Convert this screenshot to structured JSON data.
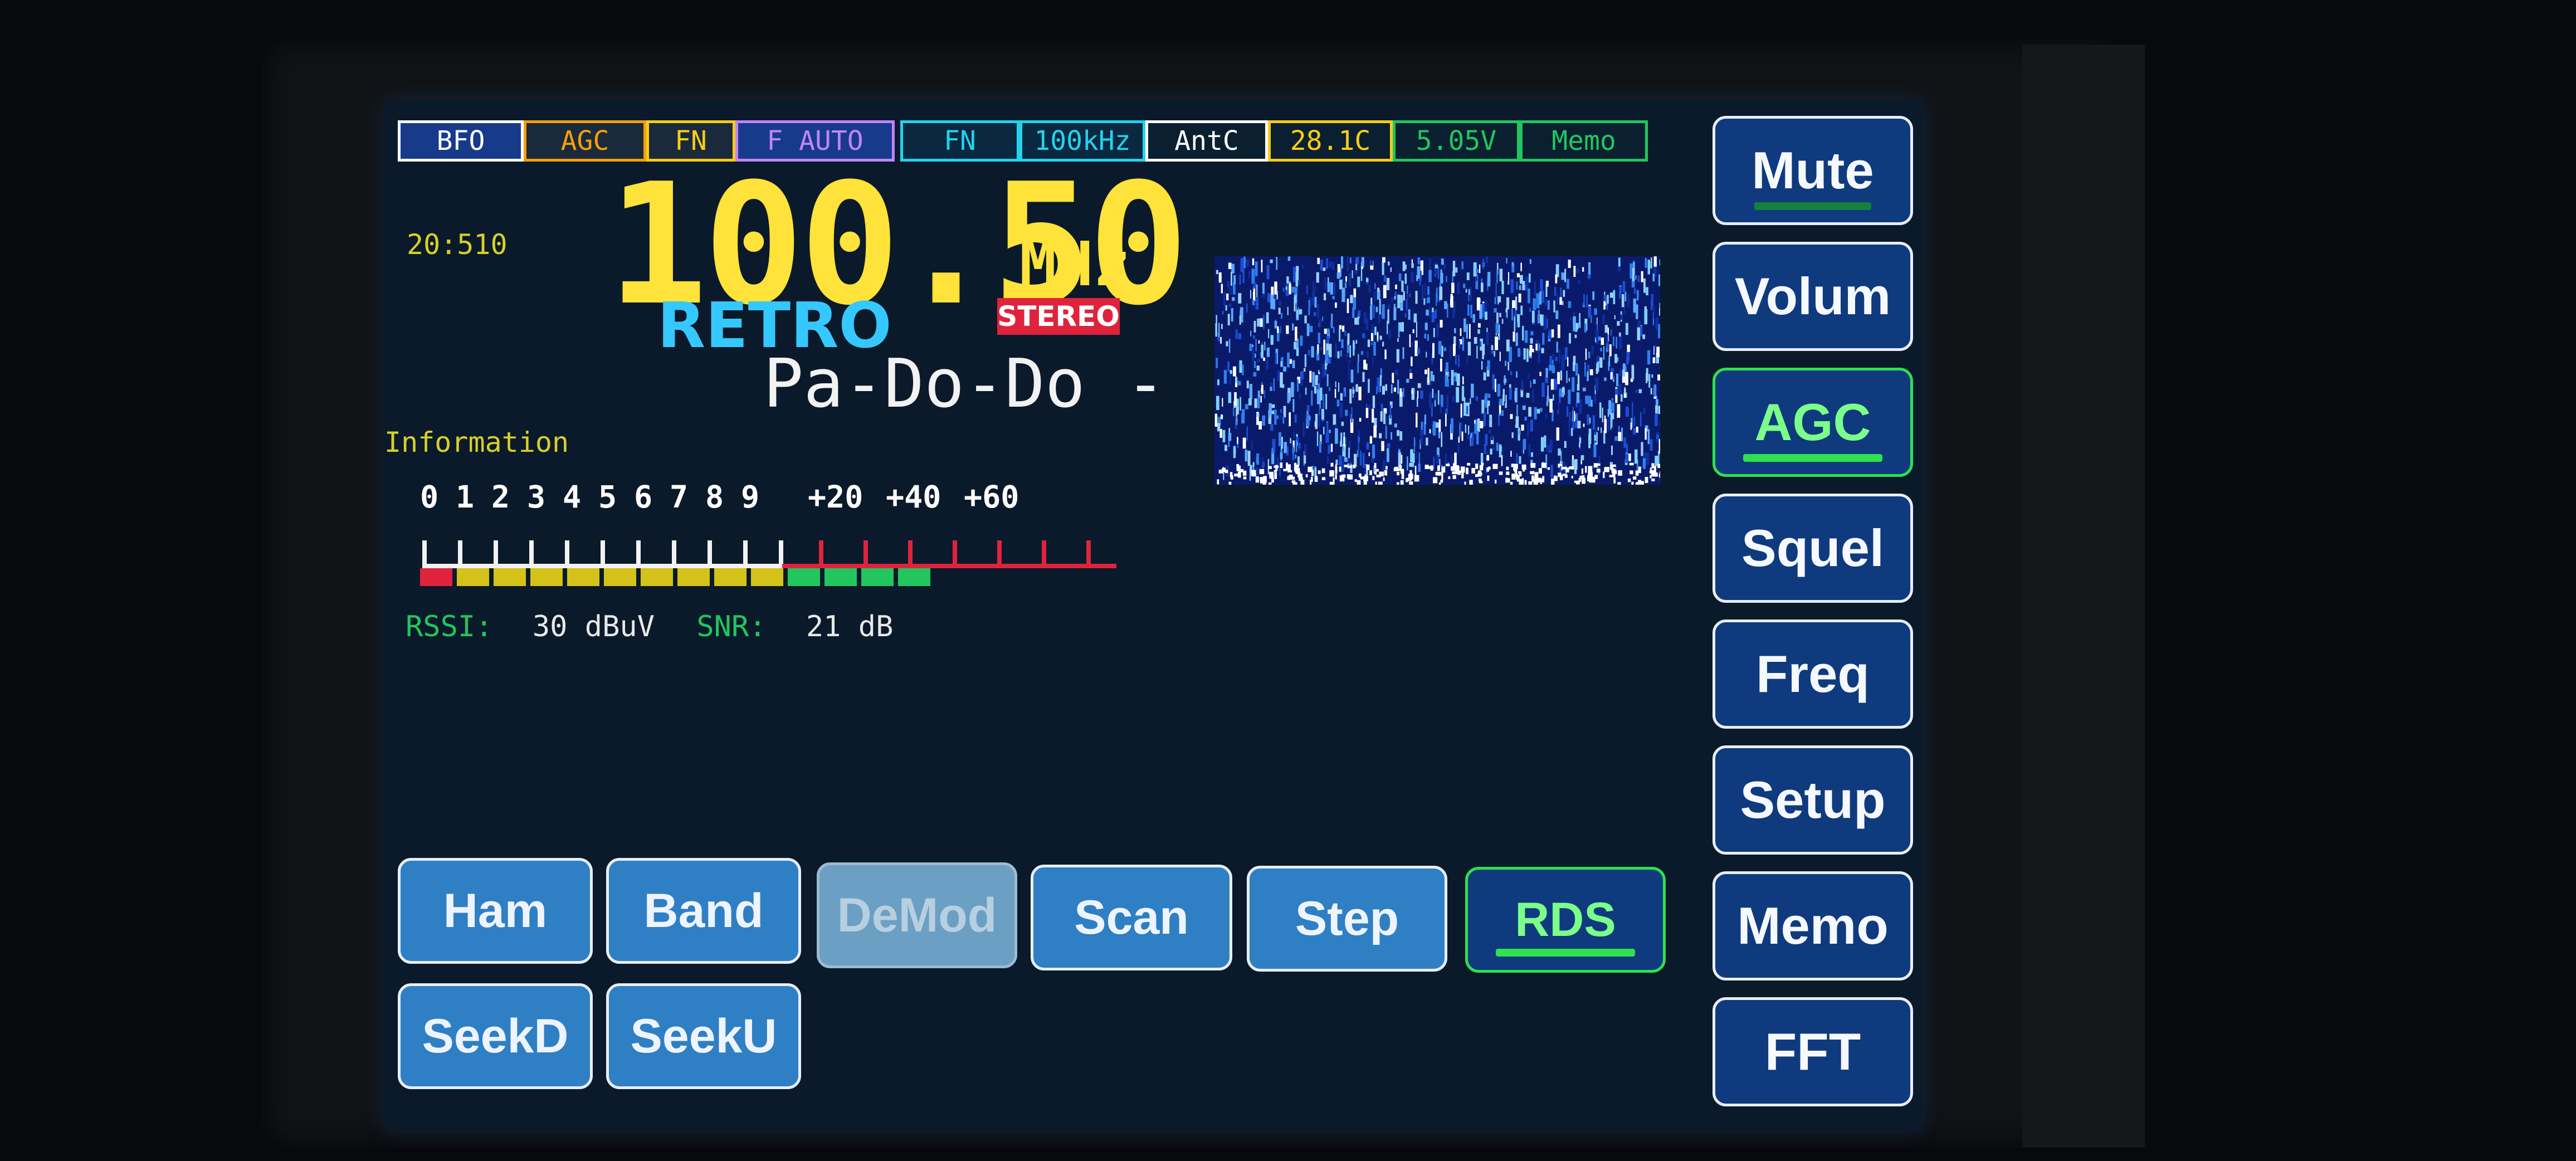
{
  "status_bar": [
    {
      "label": "BFO",
      "color": "#ffffff",
      "bg": "#173a8a"
    },
    {
      "label": "AGC",
      "color": "#f59e0b",
      "bg": "#1a2a3a"
    },
    {
      "label": "FN",
      "color": "#facc15",
      "bg": "#1a2a3a"
    },
    {
      "label": "F AUTO",
      "color": "#c084fc",
      "bg": "#173a8a"
    },
    {
      "label": "FN",
      "color": "#22d3ee",
      "bg": "#0a2840"
    },
    {
      "label": "100kHz",
      "color": "#22d3ee",
      "bg": "#0a2840"
    },
    {
      "label": "AntC",
      "color": "#ffffff",
      "bg": "#0a2030"
    },
    {
      "label": "28.1C",
      "color": "#facc15",
      "bg": "#0a2030"
    },
    {
      "label": "5.05V",
      "color": "#22c55e",
      "bg": "#0a2030"
    },
    {
      "label": "Memo",
      "color": "#22c55e",
      "bg": "#0a2030"
    }
  ],
  "clock": "20:510",
  "frequency": "100.50",
  "frequency_unit": "MHz",
  "station_name": "RETRO",
  "stereo_badge": "STEREO",
  "rds_text": "Pa-Do-Do -",
  "info_label": "Information",
  "smeter": {
    "scale_labels": [
      "0",
      "1",
      "2",
      "3",
      "4",
      "5",
      "6",
      "7",
      "8",
      "9",
      "+20",
      "+40",
      "+60"
    ],
    "segments": [
      "#e0233c",
      "#d4c21a",
      "#d4c21a",
      "#d4c21a",
      "#d4c21a",
      "#d4c21a",
      "#d4c21a",
      "#d4c21a",
      "#d4c21a",
      "#d4c21a",
      "#22c55e",
      "#22c55e",
      "#22c55e",
      "#22c55e"
    ]
  },
  "rssi": {
    "label": "RSSI:",
    "value": "30 dBuV"
  },
  "snr": {
    "label": "SNR:",
    "value": "21 dB"
  },
  "bottom_buttons": [
    {
      "label": "Ham",
      "state": "normal"
    },
    {
      "label": "Band",
      "state": "normal"
    },
    {
      "label": "DeMod",
      "state": "disabled"
    },
    {
      "label": "Scan",
      "state": "normal"
    },
    {
      "label": "Step",
      "state": "normal"
    },
    {
      "label": "RDS",
      "state": "active"
    },
    {
      "label": "SeekD",
      "state": "normal"
    },
    {
      "label": "SeekU",
      "state": "normal"
    }
  ],
  "side_buttons": [
    {
      "label": "Mute",
      "state": "normal",
      "underline": "#15803d"
    },
    {
      "label": "Volum",
      "state": "normal"
    },
    {
      "label": "AGC",
      "state": "active",
      "underline": "#2fe04f"
    },
    {
      "label": "Squel",
      "state": "normal"
    },
    {
      "label": "Freq",
      "state": "normal"
    },
    {
      "label": "Setup",
      "state": "normal"
    },
    {
      "label": "Memo",
      "state": "normal"
    },
    {
      "label": "FFT",
      "state": "normal"
    }
  ]
}
